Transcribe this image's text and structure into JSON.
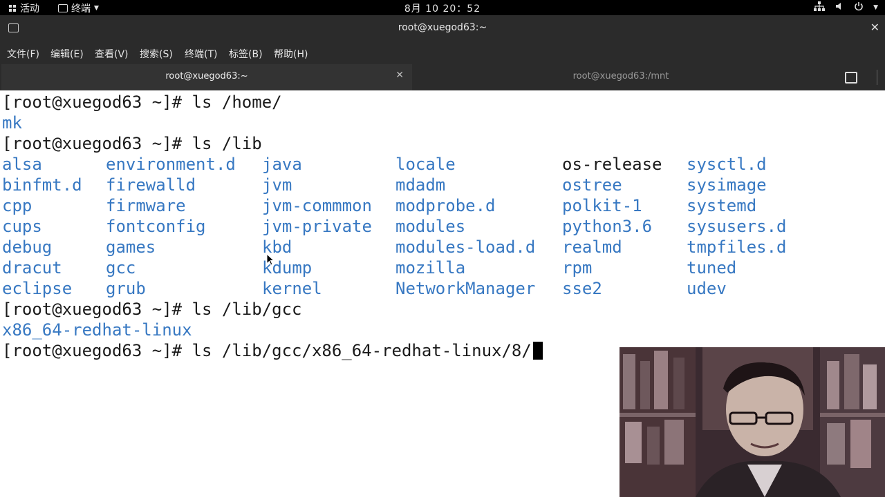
{
  "topbar": {
    "activities": "活动",
    "app_menu": "终端",
    "clock": "8月 10 20：52"
  },
  "window": {
    "title": "root@xuegod63:~"
  },
  "menu": [
    "文件(F)",
    "编辑(E)",
    "查看(V)",
    "搜索(S)",
    "终端(T)",
    "标签(B)",
    "帮助(H)"
  ],
  "tabs": [
    {
      "label": "root@xuegod63:~",
      "active": true
    },
    {
      "label": "root@xuegod63:/mnt",
      "active": false
    }
  ],
  "terminal": {
    "lines": [
      {
        "prompt": "[root@xuegod63 ~]# ",
        "cmd": "ls /home/"
      },
      {
        "output": "mk"
      },
      {
        "prompt": "[root@xuegod63 ~]# ",
        "cmd": "ls /lib"
      },
      {
        "prompt": "[root@xuegod63 ~]# ",
        "cmd": "ls /lib/gcc"
      },
      {
        "output": "x86_64-redhat-linux"
      },
      {
        "prompt": "[root@xuegod63 ~]# ",
        "cmd": "ls /lib/gcc/x86_64-redhat-linux/8/"
      }
    ],
    "lib_columns": [
      [
        "alsa",
        "binfmt.d",
        "cpp",
        "cups",
        "debug",
        "dracut",
        "eclipse"
      ],
      [
        "environment.d",
        "firewalld",
        "firmware",
        "fontconfig",
        "games",
        "gcc",
        "grub"
      ],
      [
        "java",
        "jvm",
        "jvm-commmon",
        "jvm-private",
        "kbd",
        "kdump",
        "kernel"
      ],
      [
        "locale",
        "mdadm",
        "modprobe.d",
        "modules",
        "modules-load.d",
        "mozilla",
        "NetworkManager"
      ],
      [
        "os-release",
        "ostree",
        "polkit-1",
        "python3.6",
        "realmd",
        "rpm",
        "sse2"
      ],
      [
        "sysctl.d",
        "sysimage",
        "systemd",
        "sysusers.d",
        "tmpfiles.d",
        "tuned",
        "udev"
      ]
    ]
  },
  "colors": {
    "dir_blue": "#3778c2",
    "text": "#1a1a1a",
    "chrome": "#2b2b2b",
    "topbar": "#000000"
  }
}
